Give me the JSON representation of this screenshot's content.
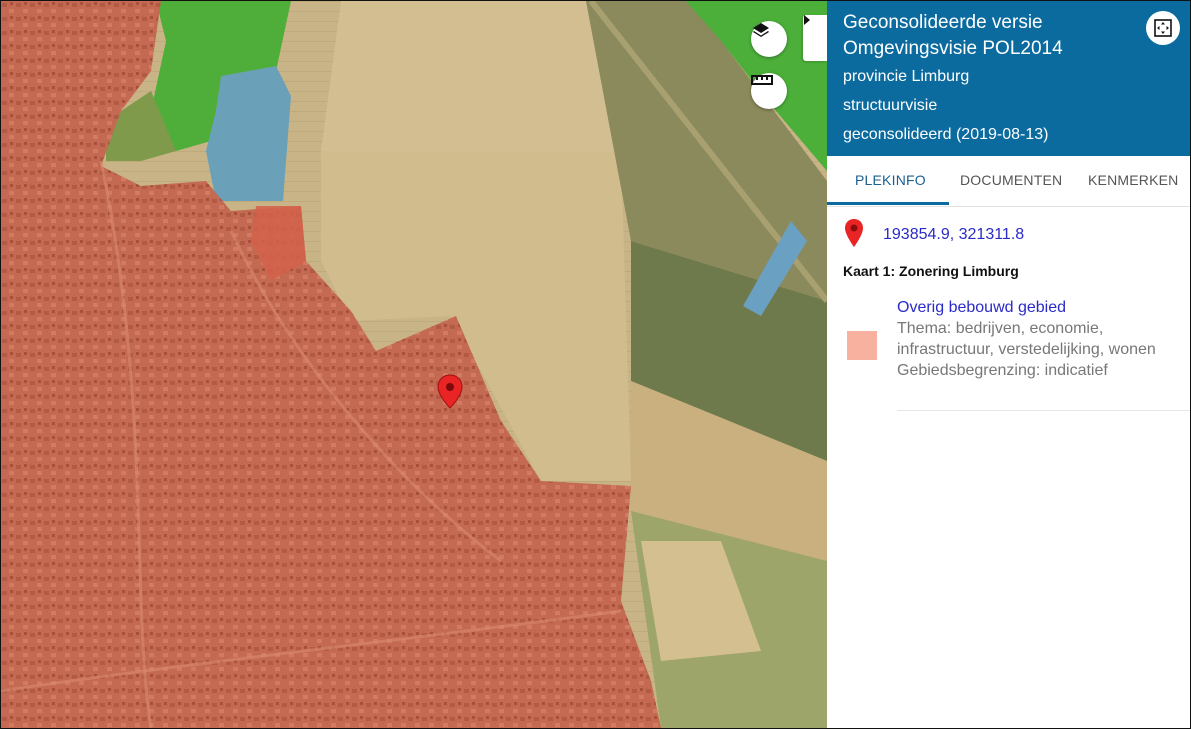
{
  "panel": {
    "title": "Geconsolideerde versie Omgevingsvisie POL2014",
    "organisation": "provincie Limburg",
    "plan_type": "structuurvisie",
    "status": "geconsolideerd (2019-08-13)",
    "header_color": "#0b6b9f",
    "tabs": [
      {
        "label": "PLEKINFO",
        "active": true
      },
      {
        "label": "DOCUMENTEN",
        "active": false
      },
      {
        "label": "KENMERKEN",
        "active": false
      }
    ],
    "coordinates": "193854.9, 321311.8",
    "kaart_title": "Kaart 1: Zonering Limburg",
    "feature": {
      "name": "Overig bebouwd gebied",
      "thema": "Thema: bedrijven, economie, infrastructuur, verstedelijking, wonen",
      "begrenzing": "Gebiedsbegrenzing: indicatief",
      "swatch_color": "#f8b19e"
    }
  },
  "map": {
    "controls": {
      "layers": "layers-icon",
      "measure": "ruler-icon",
      "collapse": "caret-right-icon",
      "fullscreen": "fullscreen-icon"
    },
    "zone_colors": {
      "bebouwd": "#c2614a",
      "natuur": "#4caf3a",
      "water": "#5a9ec9",
      "landbouw": "#c9b78a"
    }
  }
}
